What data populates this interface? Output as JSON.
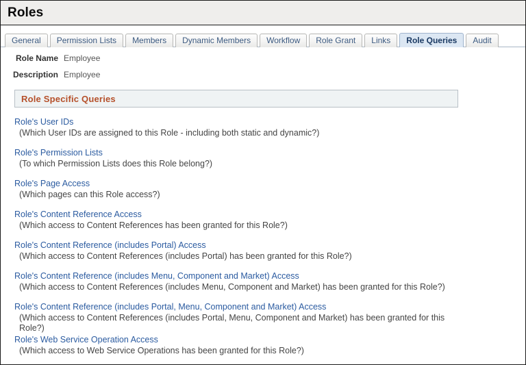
{
  "window": {
    "title": "Roles"
  },
  "tabs": [
    {
      "label": "General",
      "selected": false
    },
    {
      "label": "Permission Lists",
      "selected": false
    },
    {
      "label": "Members",
      "selected": false
    },
    {
      "label": "Dynamic Members",
      "selected": false
    },
    {
      "label": "Workflow",
      "selected": false
    },
    {
      "label": "Role Grant",
      "selected": false
    },
    {
      "label": "Links",
      "selected": false
    },
    {
      "label": "Role Queries",
      "selected": true
    },
    {
      "label": "Audit",
      "selected": false
    }
  ],
  "fields": [
    {
      "label": "Role Name",
      "value": "Employee"
    },
    {
      "label": "Description",
      "value": "Employee"
    }
  ],
  "section": {
    "title": "Role Specific Queries"
  },
  "queries": [
    {
      "link": "Role's User IDs",
      "desc": "(Which User IDs are assigned to this Role - including both static and dynamic?)",
      "tight": false
    },
    {
      "link": "Role's Permission Lists",
      "desc": "(To which Permission Lists does this Role belong?)",
      "tight": false
    },
    {
      "link": "Role's Page Access",
      "desc": "(Which pages can this Role access?)",
      "tight": false
    },
    {
      "link": "Role's Content Reference Access",
      "desc": "(Which access to Content References has been granted for this Role?)",
      "tight": false
    },
    {
      "link": "Role's Content Reference (includes Portal) Access",
      "desc": "(Which access to Content References (includes Portal) has been granted for this Role?)",
      "tight": false
    },
    {
      "link": "Role's Content Reference (includes Menu, Component and Market) Access",
      "desc": "(Which access to Content References (includes Menu, Component and Market) has been granted for this Role?)",
      "tight": false
    },
    {
      "link": "Role's Content Reference (includes Portal, Menu, Component and Market) Access",
      "desc": "(Which access to Content References (includes Portal, Menu, Component and Market) has been granted for this Role?)",
      "tight": true
    },
    {
      "link": "Role's Web Service Operation Access",
      "desc": "(Which access to Web Service Operations has been granted for this Role?)",
      "tight": true
    }
  ],
  "colors": {
    "titlebar_bg": "#efeeec",
    "tab_selected_bg": "#dce7f3",
    "section_header_text": "#b5502a",
    "section_header_bg": "#eff3f4",
    "link": "#2b5ba0",
    "description": "#444444"
  }
}
